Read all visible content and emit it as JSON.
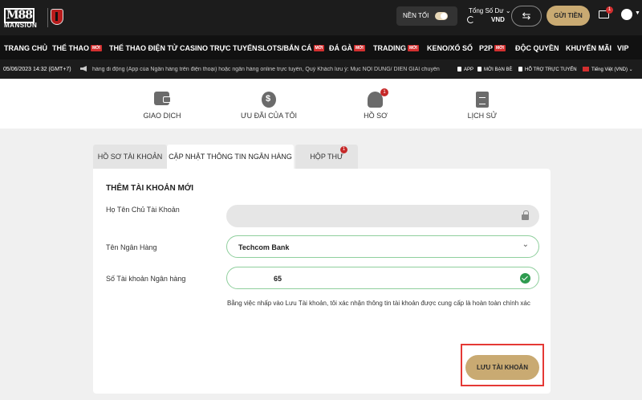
{
  "header": {
    "logo_text": "M88",
    "logo_subtext": "MANSION",
    "dark_mode_label": "NỀN TỐI",
    "balance_title": "Tổng Số Dư ⌄",
    "balance_currency": "VND",
    "transfer_icon": "⇆",
    "deposit_label": "GỬI TIỀN",
    "mail_badge": "1"
  },
  "nav": {
    "badge_label": "MỚI",
    "items": [
      {
        "label": "TRANG CHỦ"
      },
      {
        "label": "THỂ THAO"
      },
      {
        "label": "THỂ THAO ĐIỆN TỬ"
      },
      {
        "label": "CASINO TRỰC TUYẾN"
      },
      {
        "label": "SLOTS/BẮN CÁ"
      },
      {
        "label": "ĐÁ GÀ"
      },
      {
        "label": "TRADING"
      },
      {
        "label": "KENO/XỔ SỐ"
      },
      {
        "label": "P2P"
      },
      {
        "label": "ĐỘC QUYỀN"
      },
      {
        "label": "KHUYẾN MÃI"
      },
      {
        "label": "VIP"
      }
    ]
  },
  "ticker": {
    "datetime": "05/06/2023 14:32 (GMT+7)",
    "message": "hàng di động (App của Ngân hàng trên điện thoại) hoặc ngân hàng online trực tuyến, Quý Khách lưu ý: Mục NỘI DUNG/ DIỄN GIẢI chuyển",
    "app_label": "APP",
    "invite_label": "MỜI BẠN BÈ",
    "support_label": "HỖ TRỢ TRỰC TUYẾN",
    "language_label": "Tiếng Việt (VND) ⌄"
  },
  "subnav": {
    "items": [
      {
        "label": "GIAO DỊCH",
        "icon": "wallet-icon"
      },
      {
        "label": "ƯU ĐÃI CỦA TÔI",
        "icon": "coins-icon"
      },
      {
        "label": "HỒ SƠ",
        "icon": "profile-icon"
      },
      {
        "label": "LỊCH SỬ",
        "icon": "document-icon"
      }
    ],
    "profile_badge": "1"
  },
  "tabs": {
    "items": [
      {
        "label": "HỒ SƠ TÀI KHOẢN"
      },
      {
        "label": "CẬP NHẬT THÔNG TIN NGÂN HÀNG"
      },
      {
        "label": "HỘP THƯ"
      }
    ],
    "inbox_badge": "1"
  },
  "form": {
    "title": "THÊM TÀI KHOẢN MỚI",
    "holder_label": "Họ Tên Chủ Tài Khoản",
    "holder_value": "",
    "bank_label": "Tên Ngân Hàng",
    "bank_value": "Techcom Bank",
    "account_label": "Số Tài khoản Ngân hàng",
    "account_value": "65",
    "consent_text": "Bằng việc nhấp vào Lưu Tài khoản, tôi xác nhận thông tin tài khoản được cung cấp là hoàn toàn chính xác",
    "save_label": "LƯU TÀI KHOẢN"
  },
  "colors": {
    "accent_gold": "#c9aa72",
    "badge_red": "#d32f2f",
    "success_green": "#2e9b4f",
    "highlight_red": "#e53935"
  }
}
